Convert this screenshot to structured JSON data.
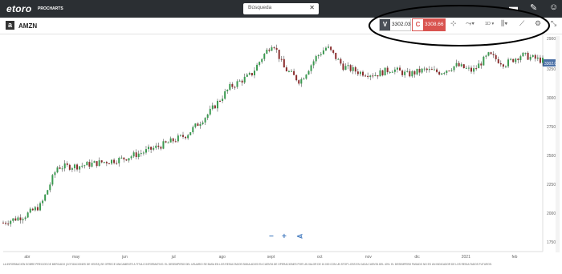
{
  "header": {
    "logo": "etoro",
    "logo_sub": "PROCHARTS",
    "search_placeholder": "Búsqueda",
    "close_symbol": "✕",
    "icons": [
      "layout-icon",
      "pencil-icon",
      "user-icon"
    ]
  },
  "instrument": {
    "badge": "a",
    "symbol": "AMZN"
  },
  "quote": {
    "sell_label": "V",
    "sell_price": "3302.03",
    "buy_label": "C",
    "buy_price": "3308.66",
    "timeframe": "1D",
    "colors": {
      "sell": "#4a4f57",
      "buy": "#d9534f"
    }
  },
  "chart_data": {
    "type": "candlestick",
    "x_labels": [
      "abr",
      "may",
      "jun",
      "jul",
      "ago",
      "sept",
      "oct",
      "nov",
      "dic",
      "2021",
      "feb"
    ],
    "y_ticks": [
      "2900",
      "3250",
      "3000",
      "2750",
      "2500",
      "2250",
      "2000",
      "1750"
    ],
    "current_price_label": "3302.03",
    "ylim": [
      1650,
      3520
    ],
    "colors": {
      "up": "#3a9a50",
      "down": "#8b2d2d"
    },
    "trend": [
      {
        "t": 0,
        "v": 1900
      },
      {
        "t": 4,
        "v": 1960
      },
      {
        "t": 7,
        "v": 2050
      },
      {
        "t": 10,
        "v": 2380
      },
      {
        "t": 14,
        "v": 2390
      },
      {
        "t": 18,
        "v": 2420
      },
      {
        "t": 22,
        "v": 2450
      },
      {
        "t": 26,
        "v": 2510
      },
      {
        "t": 30,
        "v": 2580
      },
      {
        "t": 34,
        "v": 2660
      },
      {
        "t": 38,
        "v": 2840
      },
      {
        "t": 42,
        "v": 3070
      },
      {
        "t": 46,
        "v": 3180
      },
      {
        "t": 48,
        "v": 3330
      },
      {
        "t": 50,
        "v": 3460
      },
      {
        "t": 52,
        "v": 3240
      },
      {
        "t": 55,
        "v": 3120
      },
      {
        "t": 58,
        "v": 3330
      },
      {
        "t": 60,
        "v": 3420
      },
      {
        "t": 63,
        "v": 3250
      },
      {
        "t": 66,
        "v": 3200
      },
      {
        "t": 69,
        "v": 3180
      },
      {
        "t": 72,
        "v": 3230
      },
      {
        "t": 75,
        "v": 3180
      },
      {
        "t": 78,
        "v": 3220
      },
      {
        "t": 81,
        "v": 3200
      },
      {
        "t": 84,
        "v": 3260
      },
      {
        "t": 87,
        "v": 3210
      },
      {
        "t": 90,
        "v": 3350
      },
      {
        "t": 93,
        "v": 3270
      },
      {
        "t": 96,
        "v": 3350
      },
      {
        "t": 100,
        "v": 3300
      }
    ]
  },
  "zoom": [
    "−",
    "+",
    "⋖"
  ],
  "disclaimer": "LA INFORMACIÓN SOBRE PRECIOS DE MERCADO (COTIZACIONES DE VENTA) SE OFRECE ÚNICAMENTE A TÍTULO INFORMATIVO. EL DESEMPEÑO DEL USUARIO SE BASA EN LOS RESULTADOS SIMULADOS EN CUENTA DE OPERACIONES POR UN VALOR DE 10.000 CON UN STOP LOSS EN CADA CUENTA DEL 40%. EL DESEMPEÑO PASADO NO ES UN INDICADOR DE LOS RESULTADOS FUTUROS."
}
